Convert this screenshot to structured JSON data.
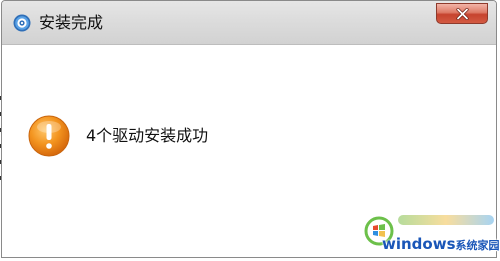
{
  "window": {
    "title": "安装完成",
    "app_icon": "gear-disc-icon",
    "close_icon": "close-icon"
  },
  "message": {
    "icon": "exclamation-warning-icon",
    "text": "4个驱动安装成功"
  },
  "watermark": {
    "brand": "windows",
    "suffix": "系统家园",
    "logo": "windows-logo-icon"
  },
  "colors": {
    "titlebar": "#dcdcdc",
    "close_button": "#c6432e",
    "warning_orange": "#ef8a1f",
    "watermark_blue": "#1a56b8"
  }
}
